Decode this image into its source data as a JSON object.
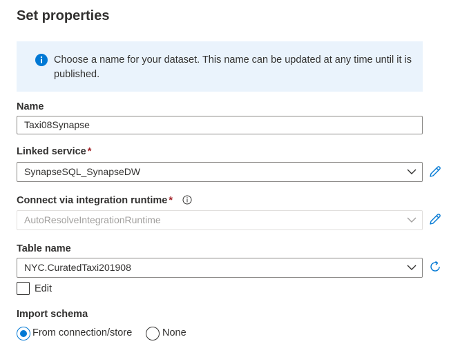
{
  "title": "Set properties",
  "info": {
    "message": "Choose a name for your dataset. This name can be updated at any time until it is published."
  },
  "name_field": {
    "label": "Name",
    "value": "Taxi08Synapse"
  },
  "linked_service": {
    "label": "Linked service",
    "required": "*",
    "value": "SynapseSQL_SynapseDW"
  },
  "integration_runtime": {
    "label": "Connect via integration runtime",
    "required": "*",
    "value": "AutoResolveIntegrationRuntime"
  },
  "table_name": {
    "label": "Table name",
    "value": "NYC.CuratedTaxi201908",
    "edit_label": "Edit",
    "edit_checked": false
  },
  "import_schema": {
    "label": "Import schema",
    "options": [
      {
        "label": "From connection/store",
        "selected": true
      },
      {
        "label": "None",
        "selected": false
      }
    ]
  },
  "colors": {
    "accent": "#0078d4",
    "info_bg": "#eaf3fc",
    "required": "#a4262c"
  },
  "icons": {
    "info": "info-circle-icon",
    "help": "info-outline-icon",
    "edit": "pencil-icon",
    "refresh": "refresh-icon",
    "chevron": "chevron-down-icon"
  }
}
